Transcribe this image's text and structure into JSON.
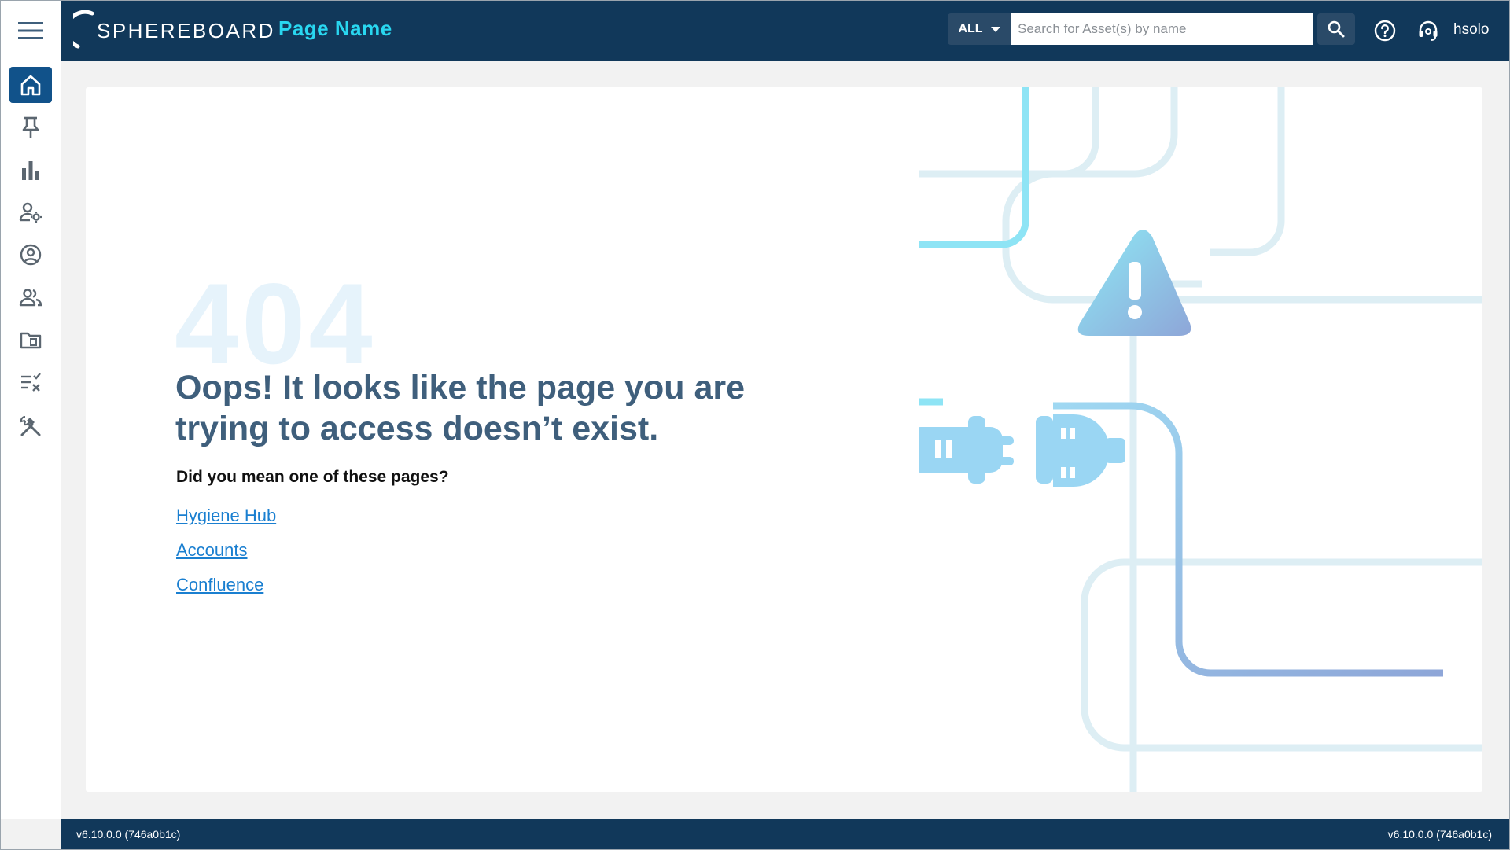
{
  "header": {
    "logo_text": "SPHEREBOARD",
    "page_name": "Page Name",
    "search": {
      "scope": "ALL",
      "placeholder": "Search for Asset(s) by name"
    },
    "username": "hsolo"
  },
  "sidebar": {
    "items": [
      {
        "icon": "home-icon",
        "active": true
      },
      {
        "icon": "pin-icon",
        "active": false
      },
      {
        "icon": "bar-chart-icon",
        "active": false
      },
      {
        "icon": "user-settings-icon",
        "active": false
      },
      {
        "icon": "account-circle-icon",
        "active": false
      },
      {
        "icon": "users-icon",
        "active": false
      },
      {
        "icon": "folder-icon",
        "active": false
      },
      {
        "icon": "checklist-icon",
        "active": false
      },
      {
        "icon": "tools-icon",
        "active": false
      }
    ]
  },
  "main": {
    "code": "404",
    "headline": "Oops! It looks like the page you are trying to access doesn’t exist.",
    "suggestions_title": "Did you mean one of these pages?",
    "links": [
      "Hygiene Hub",
      "Accounts",
      "Confluence"
    ]
  },
  "footer": {
    "version_left": "v6.10.0.0 (746a0b1c)",
    "version_right": "v6.10.0.0 (746a0b1c)"
  },
  "colors": {
    "header_bg": "#11385a",
    "accent": "#29d7f0",
    "link": "#1a7fd0",
    "active_nav": "#11528a"
  }
}
